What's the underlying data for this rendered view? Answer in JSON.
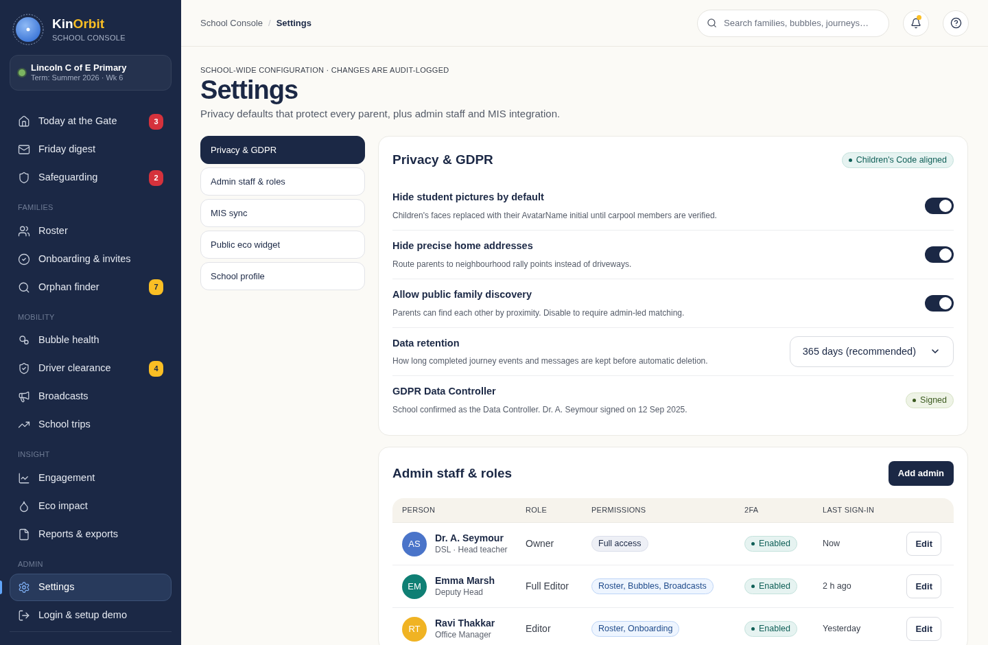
{
  "sidebar": {
    "brand": {
      "name": "Kin",
      "accent": "Orbit",
      "subtitle": "SCHOOL CONSOLE"
    },
    "school": {
      "name": "Lincoln C of E Primary",
      "term": "Term: Summer 2026 · Wk 6",
      "color": "#7cb561"
    },
    "groups": [
      {
        "items": [
          {
            "label": "Today at the Gate",
            "badge": "3",
            "color": "#d5323c",
            "selected": false
          },
          {
            "label": "Friday digest",
            "selected": false
          },
          {
            "label": "Safeguarding",
            "badge": "2",
            "color": "#d5323c",
            "selected": false
          }
        ]
      },
      {
        "title": "FAMILIES",
        "items": [
          {
            "label": "Roster",
            "selected": false
          },
          {
            "label": "Onboarding & invites",
            "selected": false
          },
          {
            "label": "Orphan finder",
            "badge": "7",
            "color": "#fbbf24",
            "selected": false
          }
        ]
      },
      {
        "title": "MOBILITY",
        "items": [
          {
            "label": "Bubble health",
            "selected": false
          },
          {
            "label": "Driver clearance",
            "badge": "4",
            "color": "#fbbf24",
            "selected": false
          },
          {
            "label": "Broadcasts",
            "selected": false
          },
          {
            "label": "School trips",
            "selected": false
          }
        ]
      },
      {
        "title": "INSIGHT",
        "items": [
          {
            "label": "Engagement",
            "selected": false
          },
          {
            "label": "Eco impact",
            "selected": false
          },
          {
            "label": "Reports & exports",
            "selected": false
          }
        ]
      },
      {
        "title": "ADMIN",
        "items": [
          {
            "label": "Settings",
            "selected": true
          },
          {
            "label": "Login & setup demo",
            "selected": false
          }
        ]
      }
    ]
  },
  "header": {
    "breadcrumb": [
      "School Console",
      "Settings"
    ],
    "separator": "/",
    "search": {
      "placeholder": "Search families, bubbles, journeys…"
    },
    "notification_dot": true
  },
  "page": {
    "eyebrow": "SCHOOL-WIDE CONFIGURATION · CHANGES ARE AUDIT-LOGGED",
    "title": "Settings",
    "subtitle": "Privacy defaults that protect every parent, plus admin staff and MIS integration."
  },
  "tabs": [
    {
      "label": "Privacy & GDPR",
      "selected": true
    },
    {
      "label": "Admin staff & roles",
      "selected": false
    },
    {
      "label": "MIS sync",
      "selected": false
    },
    {
      "label": "Public eco widget",
      "selected": false
    },
    {
      "label": "School profile",
      "selected": false
    }
  ],
  "privacy": {
    "title": "Privacy & GDPR",
    "badge": "Children's Code aligned",
    "settings": [
      {
        "kind": "toggle",
        "title": "Hide student pictures by default",
        "description": "Children's faces replaced with their AvatarName initial until carpool members are verified.",
        "on": true
      },
      {
        "kind": "toggle",
        "title": "Hide precise home addresses",
        "description": "Route parents to neighbourhood rally points instead of driveways.",
        "on": true
      },
      {
        "kind": "toggle",
        "title": "Allow public family discovery",
        "description": "Parents can find each other by proximity. Disable to require admin-led matching.",
        "on": true
      },
      {
        "kind": "select",
        "title": "Data retention",
        "description": "How long completed journey events and messages are kept before automatic deletion.",
        "value": "365 days (recommended)"
      },
      {
        "kind": "status",
        "title": "GDPR Data Controller",
        "description": "School confirmed as the Data Controller. Dr. A. Seymour signed on 12 Sep 2025.",
        "status": "Signed"
      }
    ]
  },
  "admins": {
    "title": "Admin staff & roles",
    "button": "Add admin",
    "columns": [
      "PERSON",
      "ROLE",
      "PERMISSIONS",
      "2FA",
      "LAST SIGN-IN"
    ],
    "rows": [
      {
        "initials": "AS",
        "color": "#4a74c9",
        "name": "Dr. A. Seymour",
        "subtitle": "DSL · Head teacher",
        "role": "Owner",
        "permissions": "Full access",
        "kind": "full",
        "twofa": "Enabled",
        "last": "Now",
        "action": "Edit"
      },
      {
        "initials": "EM",
        "color": "#0f7f74",
        "name": "Emma Marsh",
        "subtitle": "Deputy Head",
        "role": "Full Editor",
        "permissions": "Roster, Bubbles, Broadcasts",
        "kind": "scoped",
        "twofa": "Enabled",
        "last": "2 h ago",
        "action": "Edit"
      },
      {
        "initials": "RT",
        "color": "#f0b323",
        "name": "Ravi Thakkar",
        "subtitle": "Office Manager",
        "role": "Editor",
        "permissions": "Roster, Onboarding",
        "kind": "scoped",
        "twofa": "Enabled",
        "last": "Yesterday",
        "action": "Edit"
      }
    ]
  }
}
